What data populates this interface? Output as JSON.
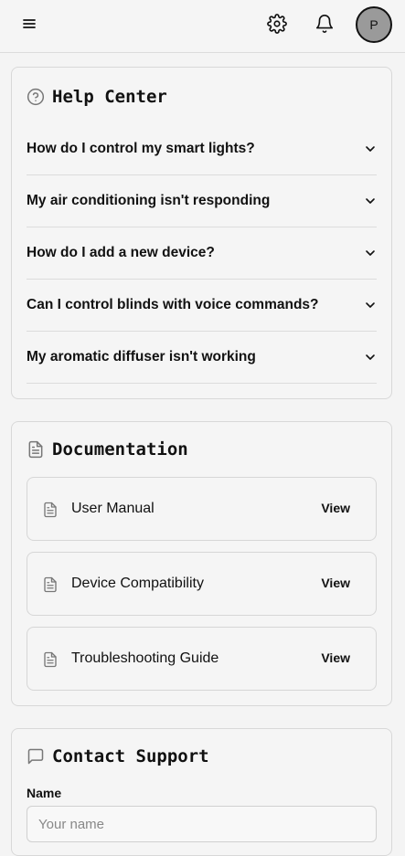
{
  "header": {
    "menu_icon": "hamburger-icon",
    "settings_icon": "gear-icon",
    "notifications_icon": "bell-icon",
    "avatar_initial": "P"
  },
  "help_center": {
    "title": "Help Center",
    "icon": "question-circle-icon",
    "faqs": [
      "How do I control my smart lights?",
      "My air conditioning isn't responding",
      "How do I add a new device?",
      "Can I control blinds with voice commands?",
      "My aromatic diffuser isn't working"
    ]
  },
  "documentation": {
    "title": "Documentation",
    "icon": "document-icon",
    "items": [
      {
        "name": "User Manual",
        "action": "View"
      },
      {
        "name": "Device Compatibility",
        "action": "View"
      },
      {
        "name": "Troubleshooting Guide",
        "action": "View"
      }
    ]
  },
  "contact_support": {
    "title": "Contact Support",
    "icon": "chat-bubble-icon",
    "name_label": "Name",
    "name_placeholder": "Your name"
  },
  "colors": {
    "background": "#f4f4f4",
    "border": "#d8d8d8",
    "avatar_bg": "#9a9a9a",
    "text": "#111111"
  }
}
